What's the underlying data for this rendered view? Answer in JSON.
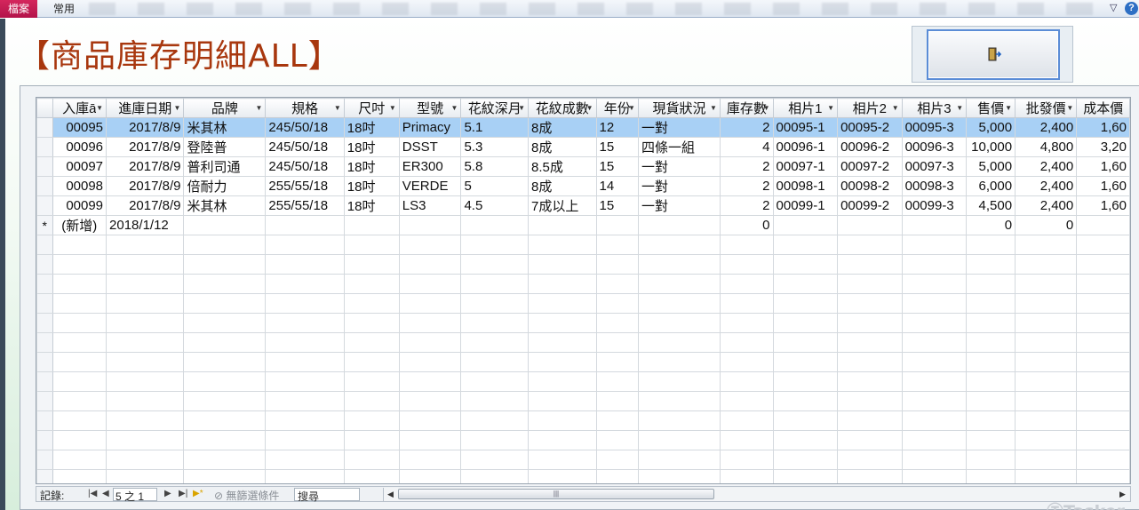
{
  "ribbon": {
    "file_tab": "檔案",
    "home_tab": "常用",
    "help": "?"
  },
  "form": {
    "title": "【商品庫存明細ALL】"
  },
  "table": {
    "headers": [
      "入庫碼",
      "進庫日期",
      "品牌",
      "規格",
      "尺吋",
      "型號",
      "花紋深度",
      "花紋成數",
      "年份",
      "現貨狀況",
      "庫存數",
      "相片1",
      "相片2",
      "相片3",
      "售價",
      "批發價",
      "成本價"
    ],
    "header_display": [
      "入庫ā",
      "進庫日期",
      "品牌",
      "規格",
      "尺吋",
      "型號",
      "花紋深月",
      "花紋成數",
      "年份",
      "現貨狀況",
      "庫存數",
      "相片1",
      "相片2",
      "相片3",
      "售價",
      "批發價",
      "成本價"
    ],
    "rows": [
      [
        "00095",
        "2017/8/9",
        "米其林",
        "245/50/18",
        "18吋",
        "Primacy",
        "5.1",
        "8成",
        "12",
        "一對",
        "2",
        "00095-1",
        "00095-2",
        "00095-3",
        "5,000",
        "2,400",
        "1,60"
      ],
      [
        "00096",
        "2017/8/9",
        "登陸普",
        "245/50/18",
        "18吋",
        "DSST",
        "5.3",
        "8成",
        "15",
        "四條一組",
        "4",
        "00096-1",
        "00096-2",
        "00096-3",
        "10,000",
        "4,800",
        "3,20"
      ],
      [
        "00097",
        "2017/8/9",
        "普利司通",
        "245/50/18",
        "18吋",
        "ER300",
        "5.8",
        "8.5成",
        "15",
        "一對",
        "2",
        "00097-1",
        "00097-2",
        "00097-3",
        "5,000",
        "2,400",
        "1,60"
      ],
      [
        "00098",
        "2017/8/9",
        "倍耐力",
        "255/55/18",
        "18吋",
        "VERDE",
        "5",
        "8成",
        "14",
        "一對",
        "2",
        "00098-1",
        "00098-2",
        "00098-3",
        "6,000",
        "2,400",
        "1,60"
      ],
      [
        "00099",
        "2017/8/9",
        "米其林",
        "255/55/18",
        "18吋",
        "LS3",
        "4.5",
        "7成以上",
        "15",
        "一對",
        "2",
        "00099-1",
        "00099-2",
        "00099-3",
        "4,500",
        "2,400",
        "1,60"
      ]
    ],
    "selected_row": 0,
    "new_row": [
      "(新增)",
      "2018/1/12",
      "",
      "",
      "",
      "",
      "",
      "",
      "",
      "",
      "0",
      "",
      "",
      "",
      "0",
      "0",
      ""
    ],
    "new_row_marker": "*"
  },
  "navbar": {
    "label": "記錄:",
    "position": "5 之 1",
    "filter": "無篩選條件",
    "search_placeholder": "搜尋"
  },
  "watermark": "Tasker"
}
